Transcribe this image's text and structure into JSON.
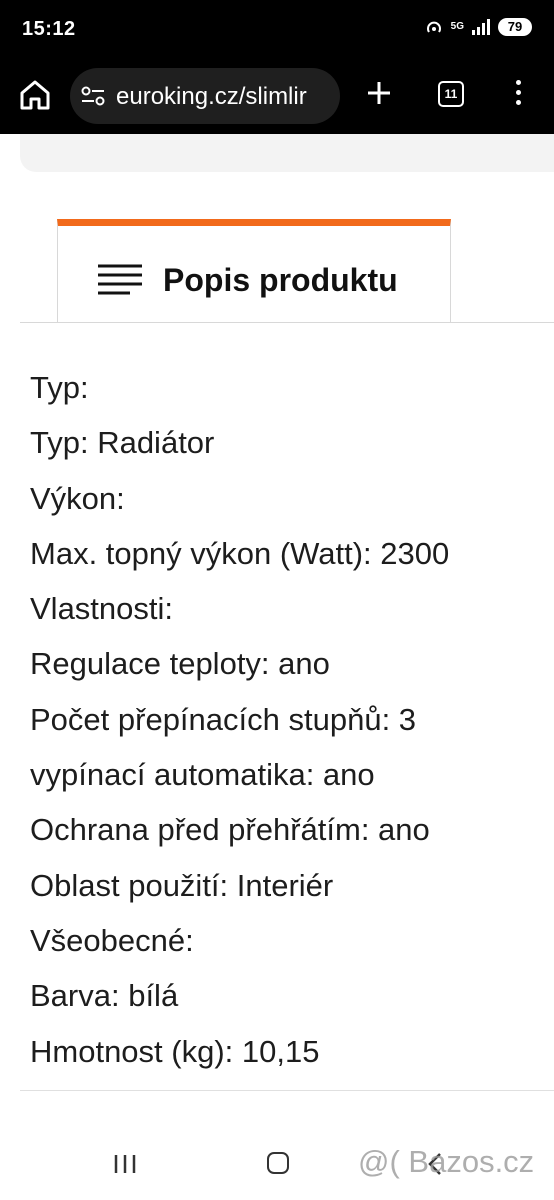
{
  "status": {
    "time": "15:12",
    "network": "5G",
    "battery": "79"
  },
  "browser": {
    "url": "euroking.cz/slimlir",
    "tab_count": "11",
    "icons": [
      "home-icon",
      "site-settings-icon",
      "new-tab-icon",
      "tab-switcher-icon",
      "menu-icon"
    ]
  },
  "tab": {
    "title": "Popis produktu",
    "accent_color": "#f26a1b"
  },
  "specs": [
    "Typ:",
    "Typ: Radiátor",
    "Výkon:",
    "Max. topný výkon (Watt): 2300",
    "Vlastnosti:",
    "Regulace teploty: ano",
    "Počet přepínacích stupňů: 3",
    "vypínací automatika: ano",
    "Ochrana před přehřátím: ano",
    "Oblast použití: Interiér",
    "Všeobecné:",
    "Barva: bílá",
    "Hmotnost (kg): 10,15"
  ],
  "watermark": "@( Bazos.cz"
}
